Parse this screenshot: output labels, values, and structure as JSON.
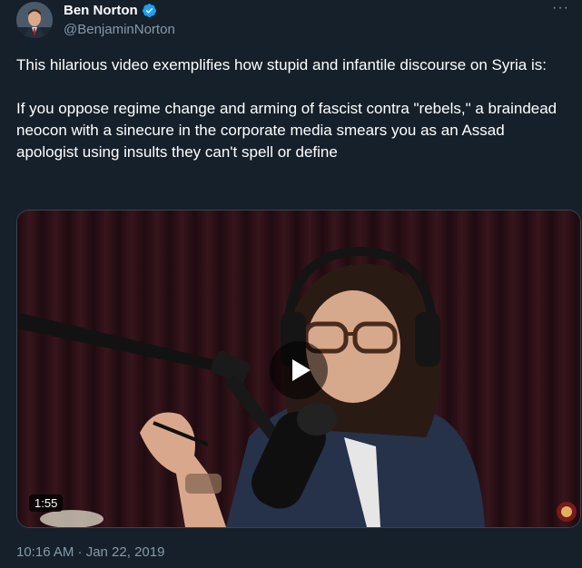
{
  "author": {
    "name": "Ben Norton",
    "handle": "@BenjaminNorton",
    "verified_icon": "verified-badge-icon"
  },
  "more_label": "···",
  "tweet": {
    "text": "This hilarious video exemplifies how stupid and infantile discourse on Syria is:\n\nIf you oppose regime change and arming of fascist contra \"rebels,\" a braindead neocon with a sinecure in the corporate media smears you as an Assad apologist using insults they can't spell or define"
  },
  "video": {
    "duration": "1:55",
    "play_icon": "play-icon"
  },
  "meta": {
    "timestamp": "10:16 AM · Jan 22, 2019"
  },
  "colors": {
    "background": "#15202b",
    "secondary_text": "#8899a6",
    "verified_blue": "#1da1f2"
  }
}
